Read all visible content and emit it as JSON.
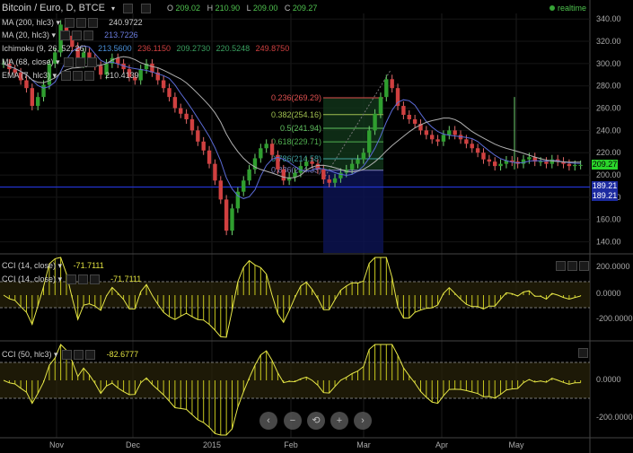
{
  "header": {
    "symbol": "Bitcoin / Euro, D, BTCE",
    "ohlc": {
      "o_label": "O",
      "o": "209.02",
      "h_label": "H",
      "h": "210.90",
      "l_label": "L",
      "l": "209.00",
      "c_label": "C",
      "c": "209.27"
    },
    "status": "realtime"
  },
  "indicators": [
    {
      "name": "MA (200, hlc3)",
      "value": "240.9722",
      "color": "#d9d9d9"
    },
    {
      "name": "MA (20, hlc3)",
      "value": "213.7226",
      "color": "#5b6bd6"
    },
    {
      "name": "Ichimoku (9, 26, 52, 26)",
      "values": [
        "213.5600",
        "236.1150",
        "209.2730",
        "220.5248",
        "249.8750"
      ],
      "colors": [
        "#4a90d9",
        "#c0392b",
        "#2e8b57",
        "#2e8b57",
        "#c0392b"
      ]
    },
    {
      "name": "MA (68, close)",
      "value": "",
      "color": "#d9d9d9"
    },
    {
      "name": "EMA (7, hlc3)",
      "value": "210.4139",
      "color": "#d9d9d9"
    }
  ],
  "cci_panels": [
    {
      "name": "CCI (14, close)",
      "value": "-71.7111",
      "name2": "CCI (14, close)",
      "value2": "-71.7111",
      "ticks": [
        "200.0000",
        "0.0000",
        "-200.0000"
      ]
    },
    {
      "name": "CCI (50, hlc3)",
      "value": "-82.6777",
      "ticks": [
        "0.0000",
        "-200.0000"
      ]
    }
  ],
  "fib": {
    "levels": [
      {
        "ratio": "0.236",
        "price": "(269.29)",
        "color": "#e05050"
      },
      {
        "ratio": "0.382",
        "price": "(254.16)",
        "color": "#a0c050"
      },
      {
        "ratio": "0.5",
        "price": "(241.94)",
        "color": "#60c060"
      },
      {
        "ratio": "0.618",
        "price": "(229.71)",
        "color": "#50b050"
      },
      {
        "ratio": "0.786",
        "price": "(214.58)",
        "color": "#40a0a0"
      },
      {
        "ratio": "0.886",
        "price": "(204.33)",
        "color": "#8080c0"
      }
    ]
  },
  "price_tags": [
    {
      "value": "209.27",
      "color": "#2bd52b",
      "text": "#000"
    },
    {
      "value": "189.21",
      "color": "#1c2aa0",
      "text": "#fff"
    },
    {
      "value": "189.21",
      "color": "#1c2aa0",
      "text": "#fff"
    }
  ],
  "nav_buttons": [
    "‹",
    "−",
    "⟲",
    "+",
    "›"
  ],
  "chart_data": {
    "type": "candlestick",
    "x_tick_labels": [
      "Nov",
      "Dec",
      "2015",
      "Feb",
      "Mar",
      "Apr",
      "May"
    ],
    "y_ticks": [
      340,
      320,
      300,
      280,
      260,
      240,
      220,
      200,
      180,
      160,
      140
    ],
    "ylim": [
      130,
      345
    ],
    "series_close": [
      300,
      295,
      292,
      285,
      278,
      262,
      270,
      281,
      300,
      310,
      335,
      325,
      315,
      300,
      310,
      305,
      298,
      290,
      300,
      305,
      300,
      295,
      288,
      285,
      295,
      300,
      292,
      285,
      278,
      270,
      260,
      255,
      250,
      240,
      230,
      222,
      210,
      195,
      178,
      150,
      170,
      185,
      195,
      205,
      215,
      224,
      228,
      218,
      205,
      195,
      198,
      202,
      208,
      212,
      210,
      205,
      196,
      193,
      197,
      202,
      205,
      210,
      214,
      220,
      240,
      255,
      270,
      286,
      278,
      262,
      254,
      250,
      246,
      240,
      236,
      232,
      230,
      236,
      240,
      236,
      232,
      228,
      224,
      220,
      214,
      212,
      208,
      210,
      213,
      212,
      210,
      214,
      216,
      212,
      212,
      210,
      214,
      212,
      210,
      208,
      209,
      209
    ],
    "horizontal_line": 189.21,
    "current": 209.27
  }
}
